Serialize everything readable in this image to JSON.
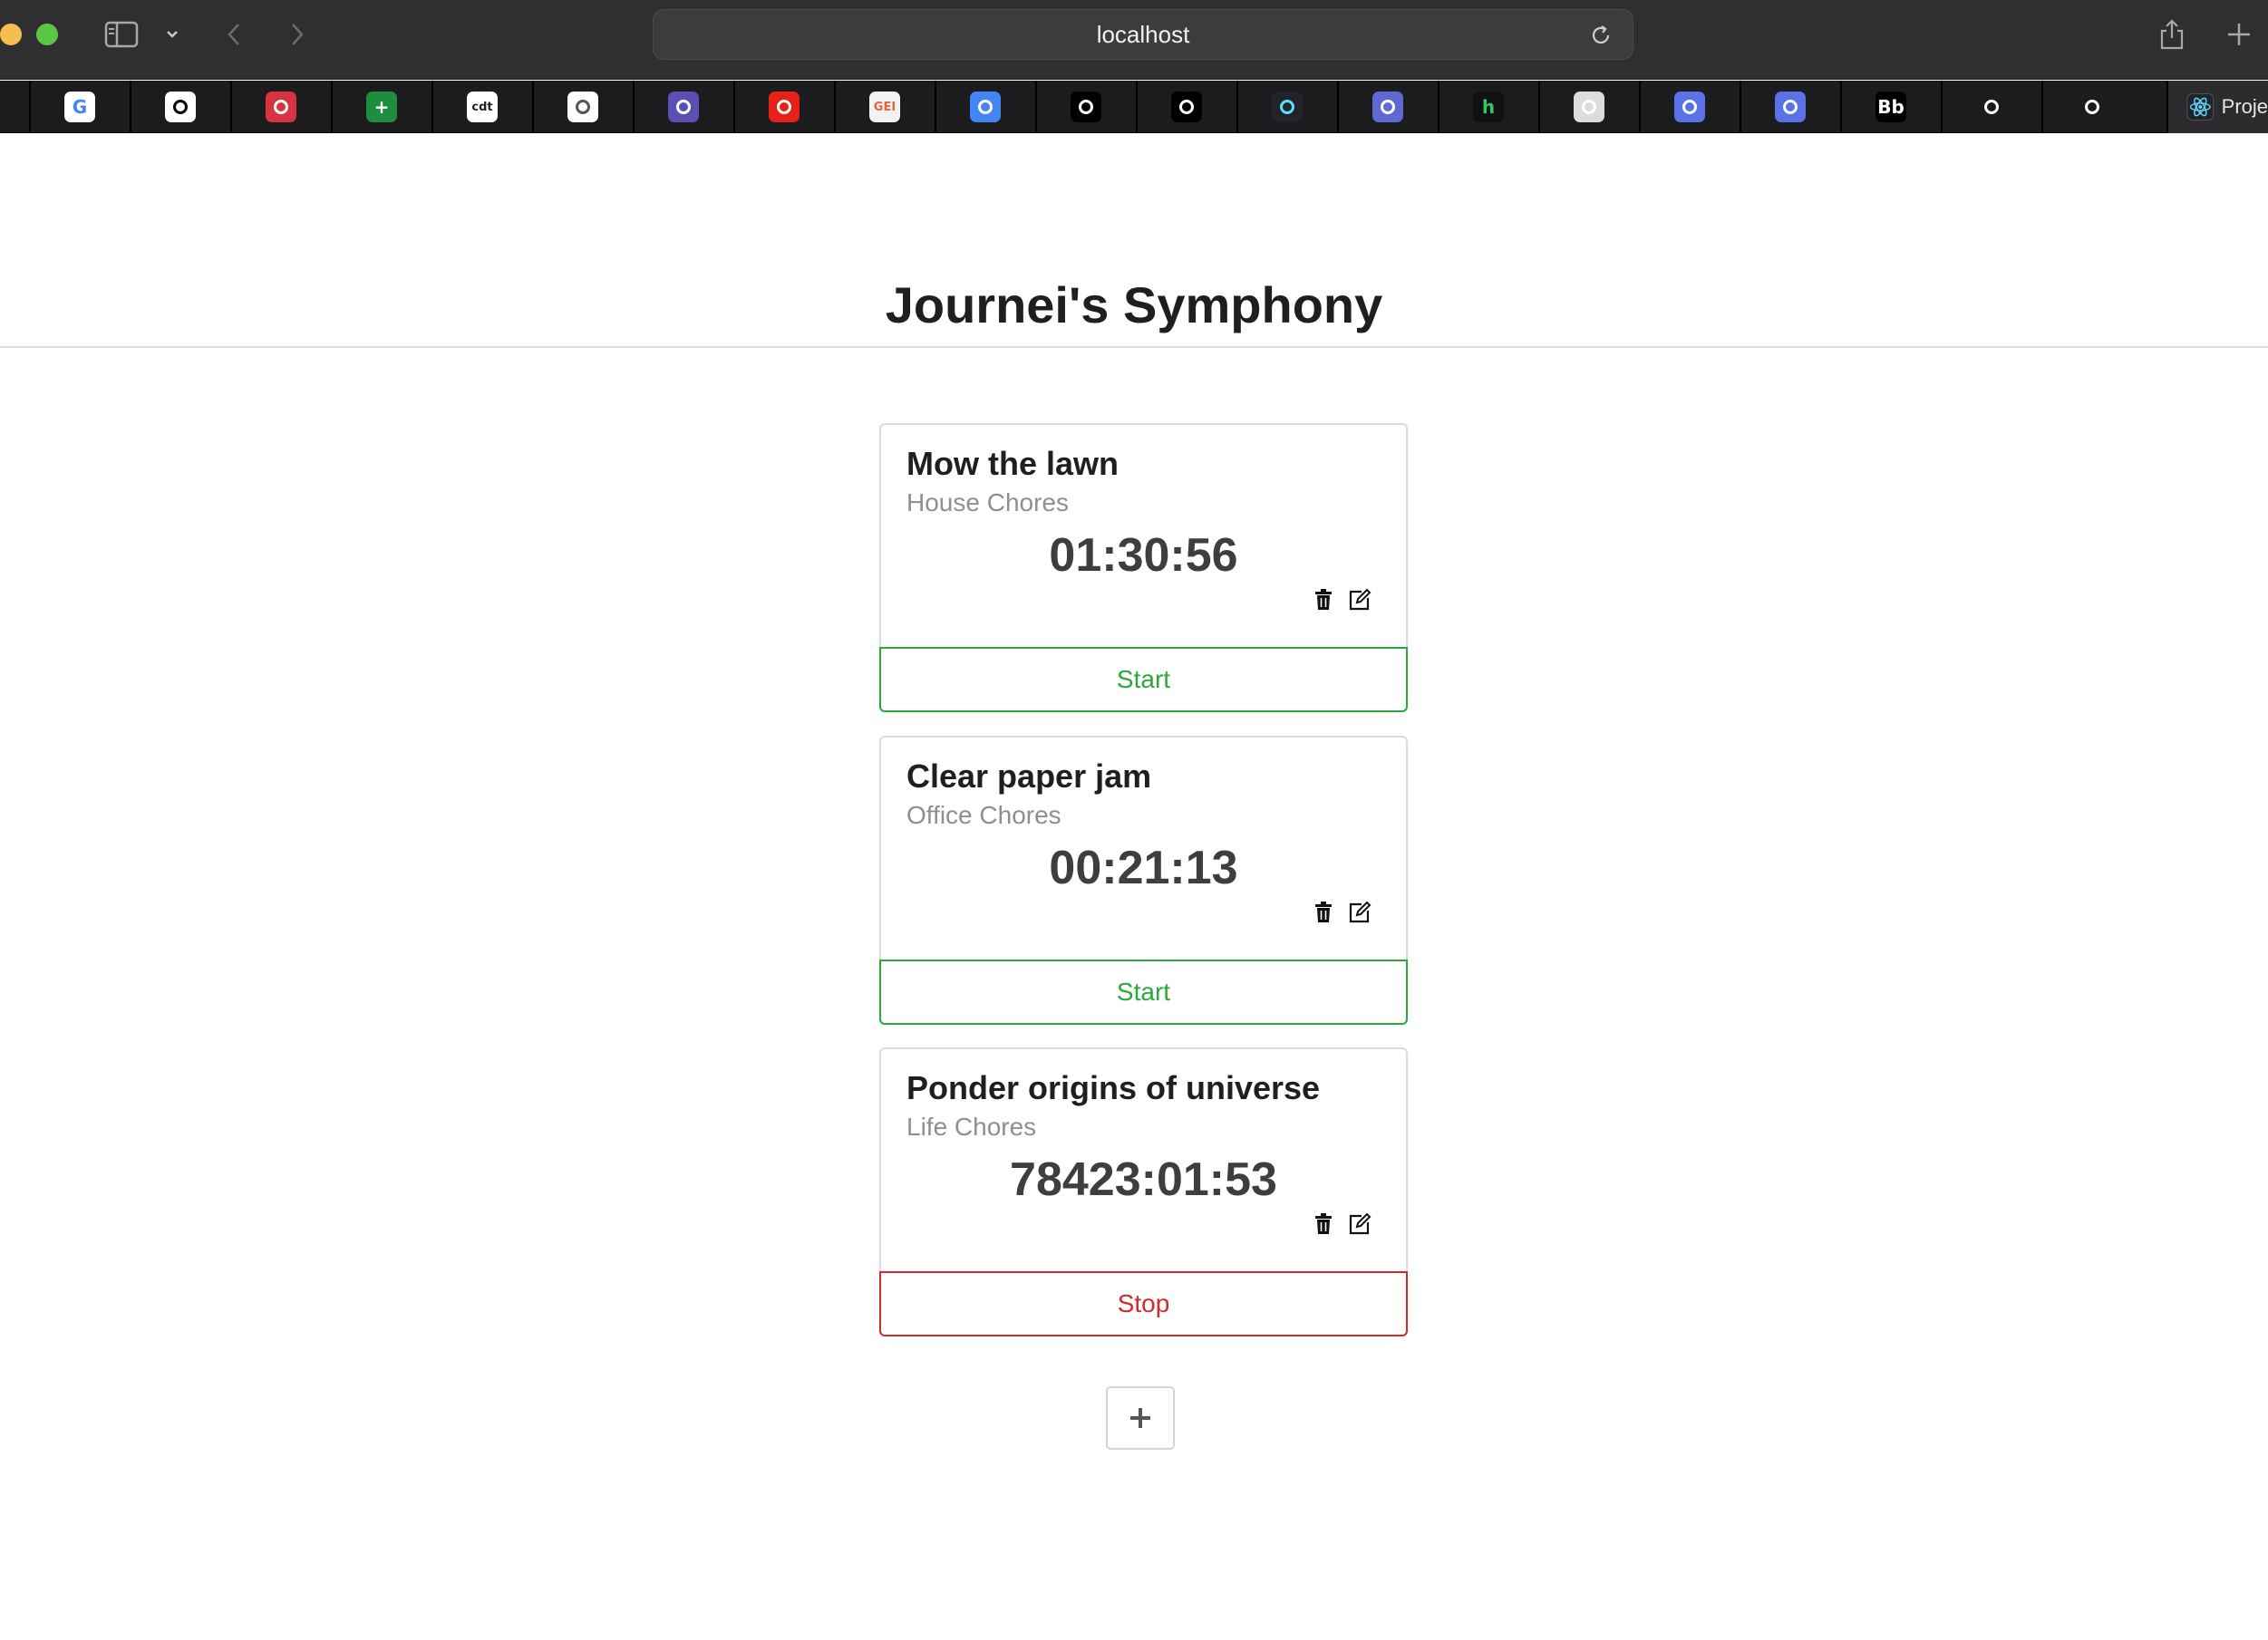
{
  "browser": {
    "url": "localhost",
    "project_tab_label": "Proje",
    "bookmarks": [
      {
        "icon": "google-icon",
        "glyph": "G",
        "bg": "#ffffff",
        "fg": "#4285f4"
      },
      {
        "icon": "github-icon",
        "glyph": "",
        "bg": "#ffffff",
        "fg": "#000000"
      },
      {
        "icon": "pocket-icon",
        "glyph": "",
        "bg": "#d9333f",
        "fg": "#ffffff"
      },
      {
        "icon": "sheets-icon",
        "glyph": "+",
        "bg": "#1e8e3e",
        "fg": "#ffffff"
      },
      {
        "icon": "cdt-icon",
        "glyph": "cdt",
        "bg": "#ffffff",
        "fg": "#222222"
      },
      {
        "icon": "ruby-docs-icon",
        "glyph": "",
        "bg": "#ffffff",
        "fg": "#555555"
      },
      {
        "icon": "robot-icon",
        "glyph": "",
        "bg": "#5b4fb5",
        "fg": "#ffffff"
      },
      {
        "icon": "youtube-icon",
        "glyph": "",
        "bg": "#e62117",
        "fg": "#ffffff"
      },
      {
        "icon": "gei-icon",
        "glyph": "GEI",
        "bg": "#f2f2f2",
        "fg": "#e8623a"
      },
      {
        "icon": "docs-icon",
        "glyph": "",
        "bg": "#4285f4",
        "fg": "#ffffff"
      },
      {
        "icon": "chatgpt-icon",
        "glyph": "",
        "bg": "#000000",
        "fg": "#ffffff"
      },
      {
        "icon": "chatgpt-icon",
        "glyph": "",
        "bg": "#000000",
        "fg": "#ffffff"
      },
      {
        "icon": "react-icon",
        "glyph": "",
        "bg": "#20232a",
        "fg": "#61dafb"
      },
      {
        "icon": "linear-icon",
        "glyph": "",
        "bg": "#5e6ad2",
        "fg": "#ffffff"
      },
      {
        "icon": "hackerrank-icon",
        "glyph": "h",
        "bg": "#111111",
        "fg": "#2ec866"
      },
      {
        "icon": "blank-icon",
        "glyph": "",
        "bg": "#dcdcdc",
        "fg": "#ffffff"
      },
      {
        "icon": "codingdojo-icon",
        "glyph": "",
        "bg": "#5a72e8",
        "fg": "#ffffff"
      },
      {
        "icon": "codingdojo-icon",
        "glyph": "",
        "bg": "#5a72e8",
        "fg": "#ffffff"
      },
      {
        "icon": "blackboard-icon",
        "glyph": "Bb",
        "bg": "#000000",
        "fg": "#ffffff"
      },
      {
        "icon": "analytics-icon",
        "glyph": "",
        "bg": "#1c1c1e",
        "fg": "#ffffff"
      },
      {
        "icon": "analytics-icon",
        "glyph": "",
        "bg": "#1c1c1e",
        "fg": "#ffffff"
      }
    ]
  },
  "app": {
    "title": "Journei's Symphony",
    "add_button_label": "+"
  },
  "timers": [
    {
      "title": "Mow the lawn",
      "project": "House Chores",
      "elapsed": "01:30:56",
      "action": "Start",
      "running": false
    },
    {
      "title": "Clear paper jam",
      "project": "Office Chores",
      "elapsed": "00:21:13",
      "action": "Start",
      "running": false
    },
    {
      "title": "Ponder origins of universe",
      "project": "Life Chores",
      "elapsed": "78423:01:53",
      "action": "Stop",
      "running": true
    }
  ],
  "colors": {
    "start": "#2ba83b",
    "stop": "#d12a2a"
  }
}
